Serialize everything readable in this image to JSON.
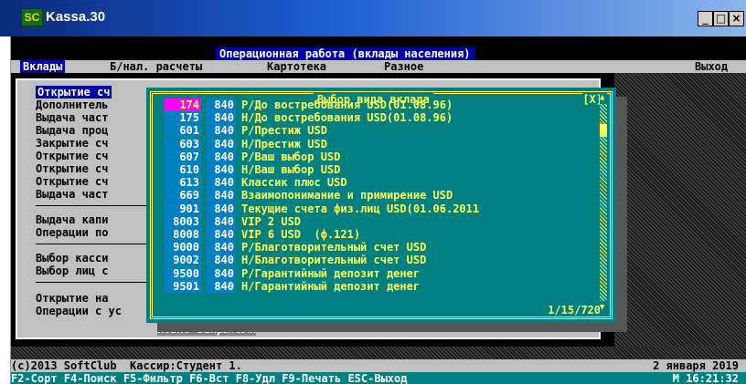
{
  "window": {
    "title": "Kassa.30",
    "icon_text": "SC",
    "btn_minimize": "_",
    "btn_maximize": "□",
    "btn_close": "×"
  },
  "banner": "Операционная работа (вклады населения)",
  "menubar": {
    "items": [
      "Вклады",
      "Б/нал. расчеты",
      "Картотека",
      "Разное"
    ],
    "exit": "Выход"
  },
  "left_menu": {
    "items": [
      "Открытие сч",
      "Дополнитель",
      "Выдача част",
      "Выдача проц",
      "Закрытие сч",
      "Открытие сч",
      "Открытие сч",
      "Открытие сч",
      "Выдача част",
      "Выдача капи",
      "Операции по",
      "Выбор касси",
      "Выбор лиц с",
      "Открытие на"
    ],
    "last_item_prefix": "Операции с ус",
    "last_item_rest": "ловно закрытыми"
  },
  "dialog": {
    "title": "Выбор вида вклада",
    "close": "[X]",
    "counter": "1/15/720",
    "rows": [
      {
        "code": "174",
        "cur": "840",
        "name": "Р/До востребования USD(01.08.96)"
      },
      {
        "code": "175",
        "cur": "840",
        "name": "Н/До востребования USD(01.08.96)"
      },
      {
        "code": "601",
        "cur": "840",
        "name": "Р/Престиж USD"
      },
      {
        "code": "603",
        "cur": "840",
        "name": "Н/Престиж USD"
      },
      {
        "code": "607",
        "cur": "840",
        "name": "Р/Ваш выбор USD"
      },
      {
        "code": "610",
        "cur": "840",
        "name": "Н/Ваш выбор USD"
      },
      {
        "code": "613",
        "cur": "840",
        "name": "Классик плюс USD"
      },
      {
        "code": "669",
        "cur": "840",
        "name": "Взаимопонимание и примирение USD"
      },
      {
        "code": "901",
        "cur": "840",
        "name": "Текущие счета физ.лиц USD(01.06.2011"
      },
      {
        "code": "8003",
        "cur": "840",
        "name": "VIP 2 USD"
      },
      {
        "code": "8008",
        "cur": "840",
        "name": "VIP 6 USD  (ф.121)"
      },
      {
        "code": "9000",
        "cur": "840",
        "name": "Р/Благотворительный счет USD"
      },
      {
        "code": "9002",
        "cur": "840",
        "name": "Н/Благотворительный счет USD"
      },
      {
        "code": "9500",
        "cur": "840",
        "name": "Р/Гарантийный депозит денег"
      },
      {
        "code": "9501",
        "cur": "840",
        "name": "Н/Гарантийный депозит денег"
      }
    ]
  },
  "status": {
    "left": "(c)2013 SoftClub  Кассир:Студент 1.",
    "date": "2 января 2019",
    "keys": "F2-Сорт F4-Поиск F5-Фильтр F6-Вст F8-Удл F9-Печать ESC-Выход",
    "time": "M 16:21:32"
  }
}
